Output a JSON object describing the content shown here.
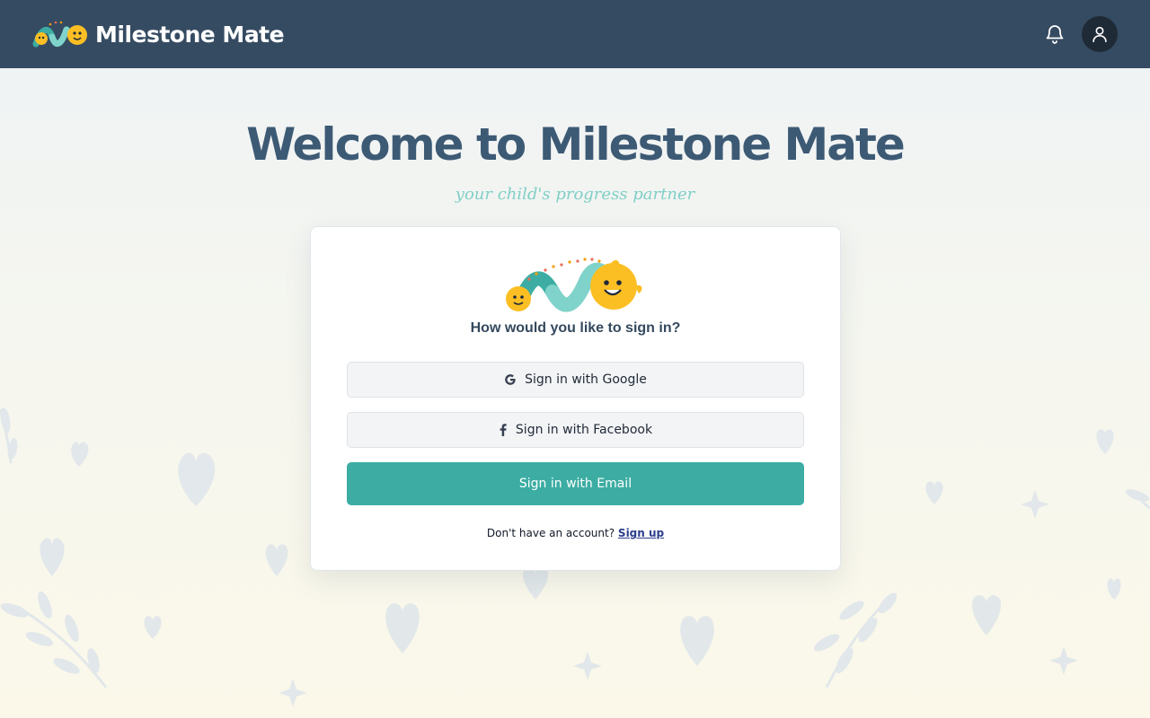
{
  "app": {
    "brand_name": "Milestone Mate"
  },
  "header": {
    "notifications_icon": "bell-icon",
    "profile_icon": "user-icon"
  },
  "hero": {
    "title": "Welcome to Milestone Mate",
    "subtitle": "your child's progress partner"
  },
  "signin": {
    "question": "How would you like to sign in?",
    "google_label": "Sign in with Google",
    "facebook_label": "Sign in with Facebook",
    "email_label": "Sign in with Email",
    "no_account_text": "Don't have an account?",
    "signup_link": "Sign up"
  },
  "colors": {
    "header_bg": "#354b62",
    "title": "#3d5a75",
    "subtitle": "#7fcfc6",
    "accent": "#3dada3",
    "link": "#2c3e8c",
    "mascot_yellow": "#fbbf24"
  }
}
